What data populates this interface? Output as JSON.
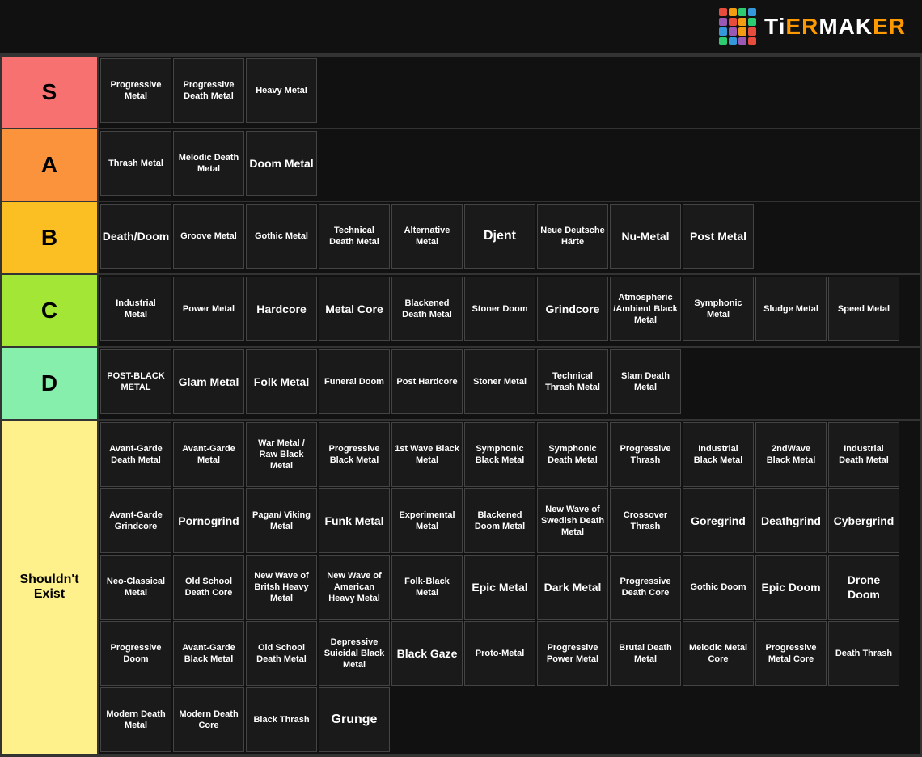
{
  "header": {
    "logo_text": "TiERMAKER",
    "logo_colors": [
      "#f00",
      "#f80",
      "#ff0",
      "#0f0",
      "#0ff",
      "#00f",
      "#f0f",
      "#f00",
      "#0f0",
      "#ff0",
      "#f80",
      "#f00",
      "#0ff",
      "#00f",
      "#f0f",
      "#0f0"
    ]
  },
  "tiers": [
    {
      "id": "S",
      "label": "S",
      "color": "#f87171",
      "items": [
        "Progressive Metal",
        "Progressive Death Metal",
        "Heavy Metal"
      ]
    },
    {
      "id": "A",
      "label": "A",
      "color": "#fb923c",
      "items": [
        "Thrash Metal",
        "Melodic Death Metal",
        "Doom Metal"
      ]
    },
    {
      "id": "B",
      "label": "B",
      "color": "#fbbf24",
      "items": [
        "Death/Doom",
        "Groove Metal",
        "Gothic Metal",
        "Technical Death Metal",
        "Alternative Metal",
        "Djent",
        "Neue Deutsche Härte",
        "Nu-Metal",
        "Post Metal"
      ]
    },
    {
      "id": "C",
      "label": "C",
      "color": "#a3e635",
      "items": [
        "Industrial Metal",
        "Power Metal",
        "Hardcore",
        "Metal Core",
        "Blackened Death Metal",
        "Stoner Doom",
        "Grindcore",
        "Atmospheric /Ambient Black Metal",
        "Symphonic Metal",
        "Sludge Metal",
        "Speed Metal"
      ]
    },
    {
      "id": "D",
      "label": "D",
      "color": "#86efac",
      "items": [
        "POST-BLACK METAL",
        "Glam Metal",
        "Folk Metal",
        "Funeral Doom",
        "Post Hardcore",
        "Stoner Metal",
        "Technical Thrash Metal",
        "Slam Death Metal"
      ]
    },
    {
      "id": "SE",
      "label": "Shouldn't Exist",
      "color": "#fef08a",
      "items_rows": [
        [
          "Avant-Garde Death Metal",
          "Avant-Garde Metal",
          "War Metal / Raw Black Metal",
          "Progressive Black Metal",
          "1st Wave Black Metal",
          "Symphonic Black Metal",
          "Symphonic Death Metal",
          "Progressive Thrash",
          "Industrial Black Metal",
          "2ndWave Black Metal",
          "Industrial Death Metal"
        ],
        [
          "Avant-Garde Grindcore",
          "Pornogrind",
          "Pagan/ Viking Metal",
          "Funk Metal",
          "Experimental Metal",
          "Blackened Doom Metal",
          "New Wave of Swedish Death Metal",
          "Crossover Thrash",
          "Goregrind",
          "Deathgrind",
          "Cybergrind"
        ],
        [
          "Neo-Classical Metal",
          "Old School Death Core",
          "New Wave of Britsh Heavy Metal",
          "New Wave of American Heavy Metal",
          "Folk-Black Metal",
          "Epic Metal",
          "Dark Metal",
          "Progressive Death Core",
          "Gothic Doom",
          "Epic Doom",
          "Drone Doom"
        ],
        [
          "Progressive Doom",
          "Avant-Garde Black Metal",
          "Old School Death Metal",
          "Depressive Suicidal Black Metal",
          "Black Gaze",
          "Proto-Metal",
          "Progressive Power Metal",
          "Brutal Death Metal",
          "Melodic Metal Core",
          "Progressive Metal Core",
          "Death Thrash"
        ],
        [
          "Modern Death Metal",
          "Modern Death Core",
          "Black Thrash",
          "Grunge"
        ]
      ]
    }
  ]
}
